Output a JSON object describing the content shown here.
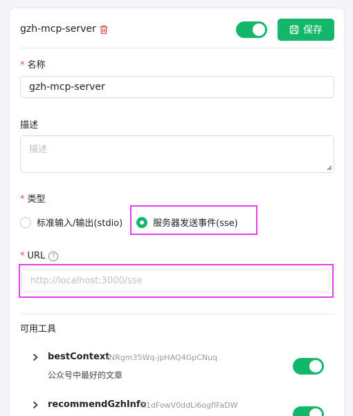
{
  "server": {
    "name": "gzh-mcp-server",
    "enabled": true
  },
  "toolbar": {
    "save_label": "保存"
  },
  "form": {
    "name_label": "名称",
    "name_value": "gzh-mcp-server",
    "description_label": "描述",
    "description_placeholder": "描述",
    "type_label": "类型",
    "type_options": [
      {
        "label": "标准输入/输出(stdio)",
        "selected": false
      },
      {
        "label": "服务器发送事件(sse)",
        "selected": true
      }
    ],
    "url_label": "URL",
    "url_placeholder": "http://localhost:3000/sse"
  },
  "tools": {
    "title": "可用工具",
    "items": [
      {
        "name": "bestContext",
        "id": "fNRgm35Wq-jpHAQ4GpCNuq",
        "description": "公众号中最好的文章",
        "enabled": true
      },
      {
        "name": "recommendGzhInfo",
        "id": "fl1dFowV0ddLi6ogfIFaDW",
        "description": "",
        "enabled": true
      }
    ]
  },
  "colors": {
    "accent": "#12b76a",
    "required": "#e5484d",
    "highlight": "#e83ce8"
  }
}
